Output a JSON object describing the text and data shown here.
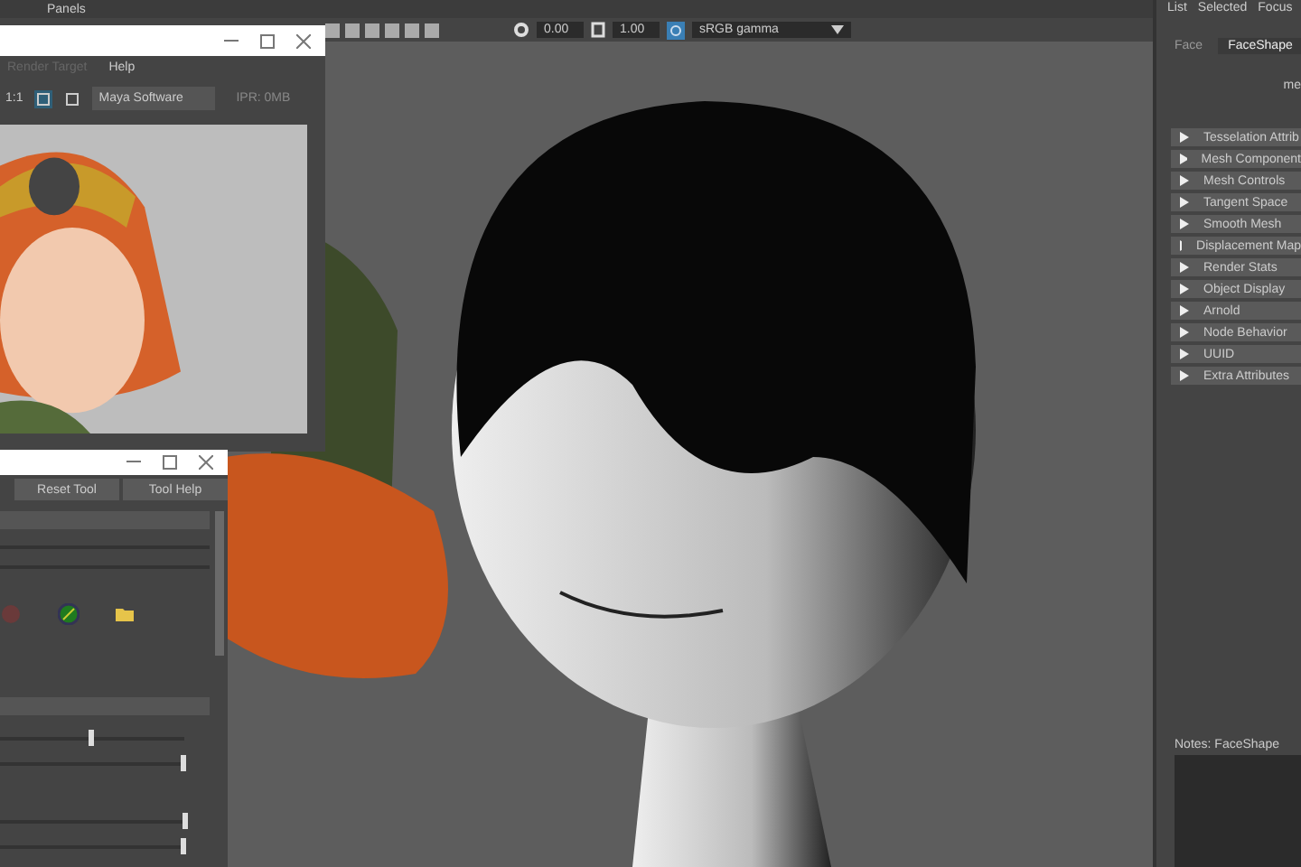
{
  "main_menu": [
    "Panels"
  ],
  "viewport_toolbar": {
    "exposure": "0.00",
    "gamma": "1.00",
    "view_transform": "sRGB gamma"
  },
  "render_view": {
    "menu": [
      {
        "label": "Render Target",
        "disabled": true
      },
      {
        "label": "Help",
        "disabled": false
      }
    ],
    "ratio": "1:1",
    "renderer": "Maya Software",
    "ipr": "IPR: 0MB"
  },
  "tool_settings": {
    "buttons": [
      "Reset Tool",
      "Tool Help"
    ],
    "sliders": [
      {
        "level": 0.48
      },
      {
        "level": 0.98
      },
      {
        "level": 0.99
      },
      {
        "level": 0.98
      }
    ]
  },
  "attribute_editor": {
    "menu": [
      "List",
      "Selected",
      "Focus"
    ],
    "tabs": [
      {
        "label": "Face",
        "selected": false
      },
      {
        "label": "FaceShape",
        "selected": true
      }
    ],
    "partial_label": "me",
    "sections": [
      "Tesselation Attrib",
      "Mesh Component",
      "Mesh Controls",
      "Tangent Space",
      "Smooth Mesh",
      "Displacement Map",
      "Render Stats",
      "Object Display",
      "Arnold",
      "Node Behavior",
      "UUID",
      "Extra Attributes"
    ],
    "notes": "Notes: FaceShape"
  }
}
